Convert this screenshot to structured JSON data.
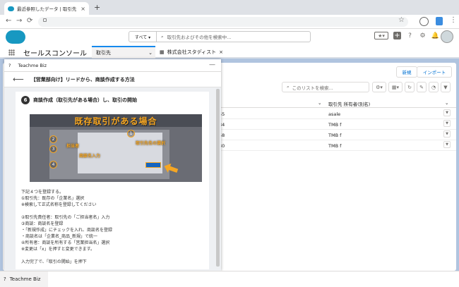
{
  "browser": {
    "tab_title": "最近参照したデータ | 取引先 | Sal",
    "tab_close": "×",
    "new_tab": "+"
  },
  "sf_header": {
    "scope_label": "すべて ▾",
    "search_placeholder": "取引先およびその他を検索中..."
  },
  "nav": {
    "app_name": "セールスコンソール",
    "tab1_label": "取引先",
    "tab2_label": "株式会社スタディスト"
  },
  "list": {
    "new_button": "新規",
    "import_button": "インポート",
    "search_placeholder": "このリストを検索...",
    "column_header": "取引先 所有者(別名)",
    "rows": [
      {
        "col_a": "55",
        "owner": "asale"
      },
      {
        "col_a": "34",
        "owner": "TMB f"
      },
      {
        "col_a": "58",
        "owner": "TMB f"
      },
      {
        "col_a": "30",
        "owner": "TMB f"
      }
    ]
  },
  "panel": {
    "title": "Teachme Biz",
    "minimize": "—",
    "article_title": "【営業部向け】リードから、商談作成する方法",
    "step_number": "6",
    "step_title": "商談作成（取引先がある場合）し、取引の開始",
    "image_banner": "既存取引がある場合",
    "callouts": {
      "c1": "取引先名の選択",
      "c2": "担当者",
      "c3": "商談名入力"
    },
    "description": [
      "下記４つを登録する。",
      "①取引先：既存の「企業名」選択",
      "※検索して正式名称を登録してください",
      "",
      "②取引先責任者：取引先の「ご担当者名」入力",
      "③商談：商談名を登録",
      "・「新規作成」にチェックを入れ、商談名を登録",
      "・商談名は「企業名_商品_新規」で統一",
      "④所有者：商談を所有する「営業担当名」選択",
      "※変更は「x」を押すと変更できます。",
      "",
      "入力完了で、「取引の開始」を押下"
    ]
  },
  "utility_bar": {
    "label": "Teachme Biz"
  },
  "colors": {
    "salesforce_blue": "#1798c1",
    "link_blue": "#0070d2",
    "accent_orange": "#f5a623"
  }
}
